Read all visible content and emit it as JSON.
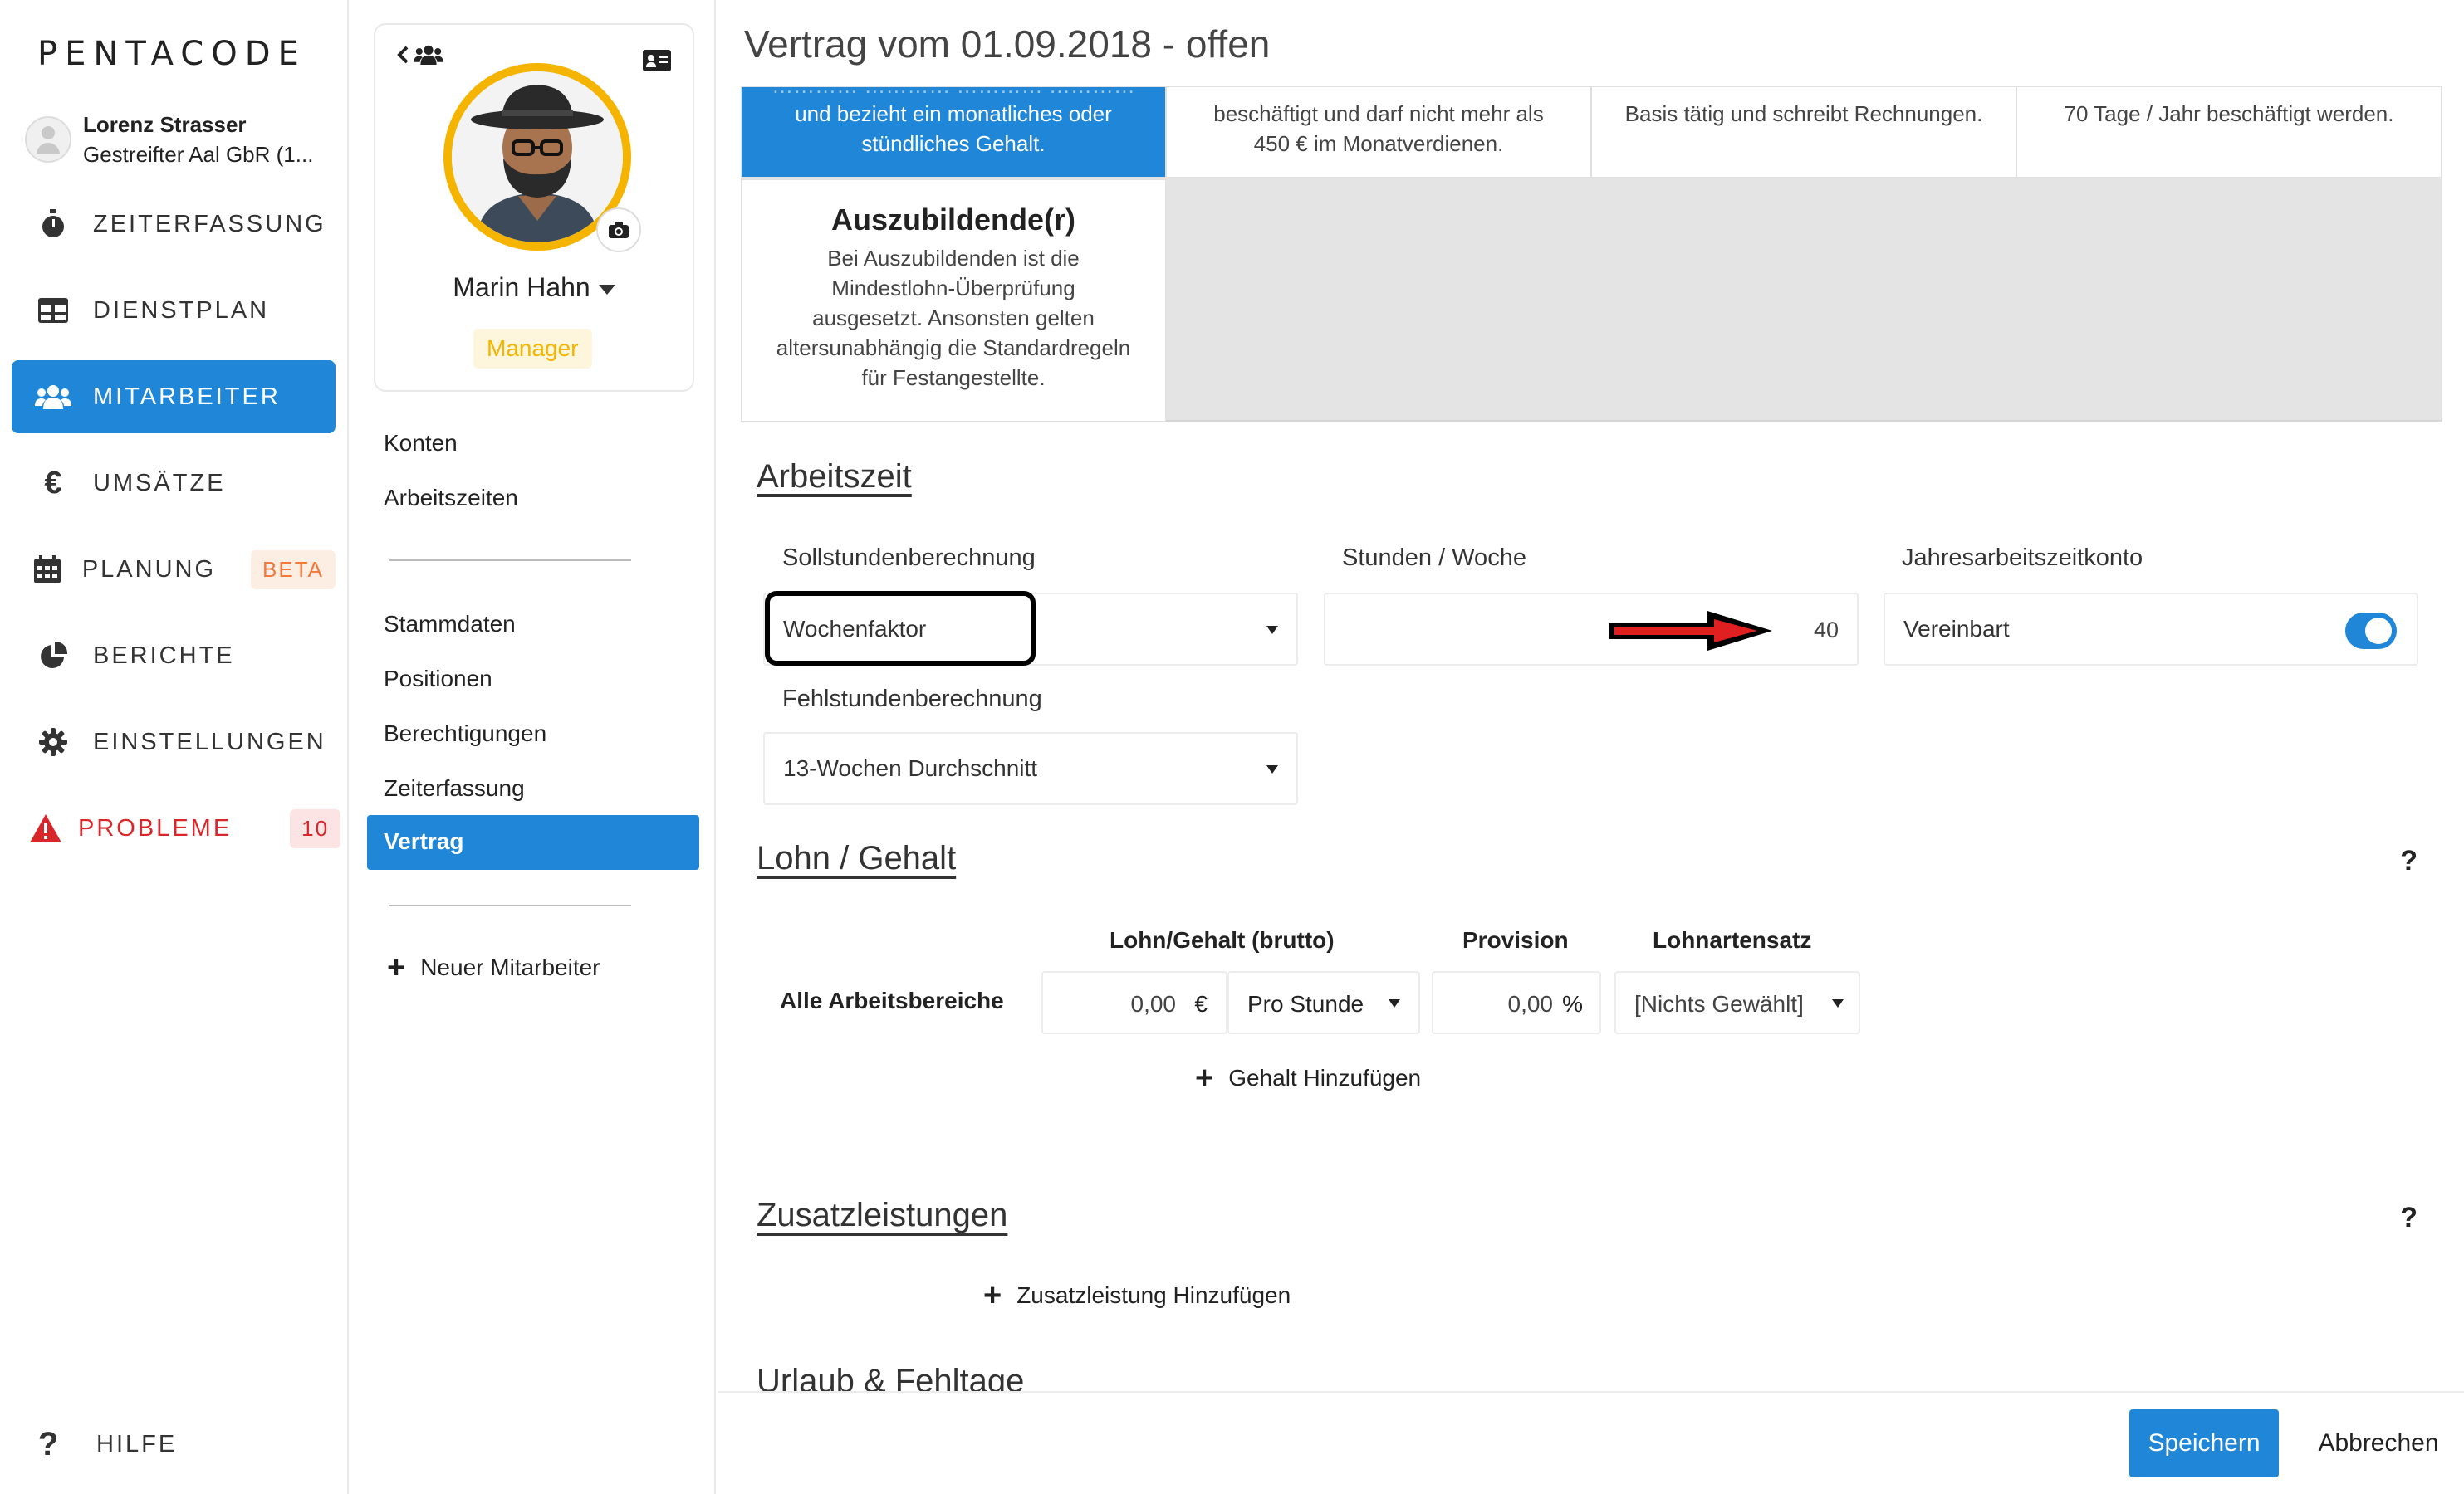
{
  "app": {
    "logo": "PENTACODE"
  },
  "user": {
    "name": "Lorenz Strasser",
    "company": "Gestreifter Aal GbR (1..."
  },
  "nav": {
    "items": [
      {
        "label": "ZEITERFASSUNG",
        "icon": "stopwatch-icon"
      },
      {
        "label": "DIENSTPLAN",
        "icon": "table-icon"
      },
      {
        "label": "MITARBEITER",
        "icon": "users-icon",
        "active": true
      },
      {
        "label": "UMSÄTZE",
        "icon": "euro-icon"
      },
      {
        "label": "PLANUNG",
        "icon": "calendar-icon",
        "badge": "BETA"
      },
      {
        "label": "BERICHTE",
        "icon": "pie-chart-icon"
      },
      {
        "label": "EINSTELLUNGEN",
        "icon": "gear-icon"
      },
      {
        "label": "PROBLEME",
        "icon": "warning-icon",
        "badge": "10"
      }
    ],
    "help": "HILFE"
  },
  "profile": {
    "name": "Marin Hahn",
    "role": "Manager",
    "menu_top": [
      "Konten",
      "Arbeitszeiten"
    ],
    "menu_mid": [
      "Stammdaten",
      "Positionen",
      "Berechtigungen",
      "Zeiterfassung",
      "Vertrag"
    ],
    "active": "Vertrag",
    "new_employee": "Neuer Mitarbeiter"
  },
  "main": {
    "title": "Vertrag vom 01.09.2018 - offen",
    "types": [
      {
        "lines": [
          "und bezieht ein monatliches oder",
          "stündliches Gehalt."
        ],
        "selected": true
      },
      {
        "lines": [
          "beschäftigt und darf nicht mehr als",
          "450 € im Monatverdienen."
        ]
      },
      {
        "lines": [
          "Basis tätig und schreibt Rechnungen."
        ]
      },
      {
        "lines": [
          "70 Tage / Jahr beschäftigt werden."
        ]
      }
    ],
    "apprentice": {
      "title": "Auszubildende(r)",
      "lines": [
        "Bei Auszubildenden ist die",
        "Mindestlohn-Überprüfung",
        "ausgesetzt. Ansonsten gelten",
        "altersunabhängig die Standardregeln",
        "für Festangestellte."
      ]
    },
    "arbeitszeit": {
      "heading": "Arbeitszeit",
      "soll_label": "Sollstundenberechnung",
      "soll_value": "Wochenfaktor",
      "stunden_label": "Stunden / Woche",
      "stunden_value": "40",
      "jahres_label": "Jahresarbeitszeitkonto",
      "jahres_value": "Vereinbart",
      "jahres_on": true,
      "fehl_label": "Fehlstundenberechnung",
      "fehl_value": "13-Wochen Durchschnitt"
    },
    "lohn": {
      "heading": "Lohn / Gehalt",
      "help": "?",
      "col_gehalt": "Lohn/Gehalt (brutto)",
      "col_provision": "Provision",
      "col_lohnart": "Lohnartensatz",
      "row_label": "Alle Arbeitsbereiche",
      "gehalt_value": "0,00",
      "gehalt_unit": "€",
      "rate_value": "Pro Stunde",
      "provision_value": "0,00",
      "provision_unit": "%",
      "lohnart_value": "[Nichts Gewählt]",
      "add": "Gehalt Hinzufügen"
    },
    "zusatz": {
      "heading": "Zusatzleistungen",
      "help": "?",
      "add": "Zusatzleistung Hinzufügen"
    },
    "next_heading": "Urlaub & Fehltage",
    "buttons": {
      "save": "Speichern",
      "cancel": "Abbrechen"
    },
    "colors": {
      "accent": "#1f86d8",
      "manager": "#f4b400",
      "danger": "#d9262b",
      "arrow": "#e02020"
    }
  }
}
